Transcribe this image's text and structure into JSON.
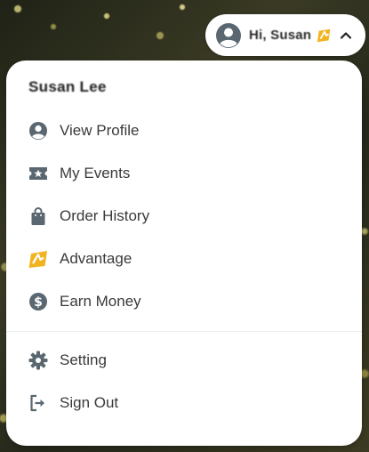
{
  "account_pill": {
    "greeting": "Hi, Susan",
    "avatar_icon": "user-circle-icon",
    "badge_icon": "advantage-badge-icon",
    "chevron_icon": "chevron-up-icon"
  },
  "menu": {
    "user_name": "Susan Lee",
    "items": [
      {
        "label": "View Profile",
        "icon": "user-circle-icon"
      },
      {
        "label": "My Events",
        "icon": "ticket-star-icon"
      },
      {
        "label": "Order History",
        "icon": "shopping-bag-icon"
      },
      {
        "label": "Advantage",
        "icon": "advantage-badge-icon"
      },
      {
        "label": "Earn Money",
        "icon": "dollar-circle-icon"
      }
    ],
    "footer_items": [
      {
        "label": "Setting",
        "icon": "gear-icon"
      },
      {
        "label": "Sign Out",
        "icon": "sign-out-icon"
      }
    ]
  },
  "colors": {
    "icon_gray": "#5a6770",
    "accent_yellow": "#f2b321",
    "text": "#3a3a3a"
  }
}
